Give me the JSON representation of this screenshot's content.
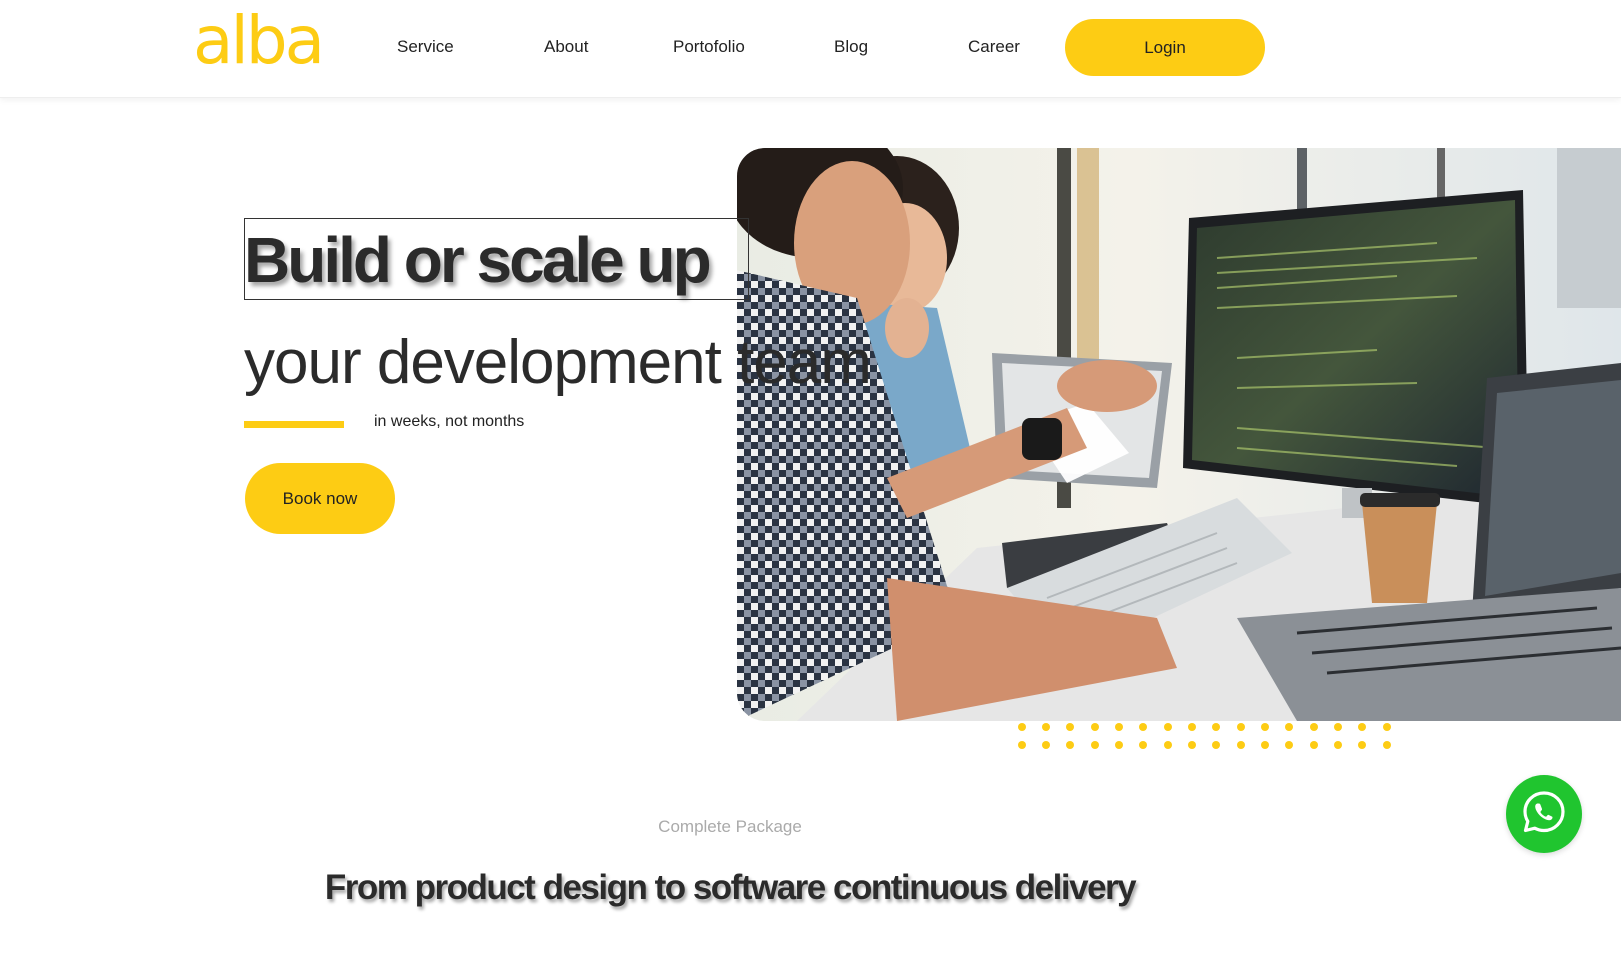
{
  "brand": {
    "logo_text": "alba",
    "accent_color": "#FDCC14"
  },
  "nav": {
    "items": [
      {
        "label": "Service"
      },
      {
        "label": "About"
      },
      {
        "label": "Portofolio"
      },
      {
        "label": "Blog"
      },
      {
        "label": "Career"
      }
    ],
    "login_label": "Login"
  },
  "hero": {
    "title": "Build or scale up",
    "subtitle": "your development team",
    "tagline": "in weeks, not months",
    "cta_label": "Book now",
    "image_subject": "developers-working-at-computers-photo"
  },
  "section": {
    "eyebrow": "Complete Package",
    "title": "From product design to software continuous delivery"
  },
  "chat": {
    "icon": "whatsapp-icon",
    "color": "#20C52F"
  }
}
